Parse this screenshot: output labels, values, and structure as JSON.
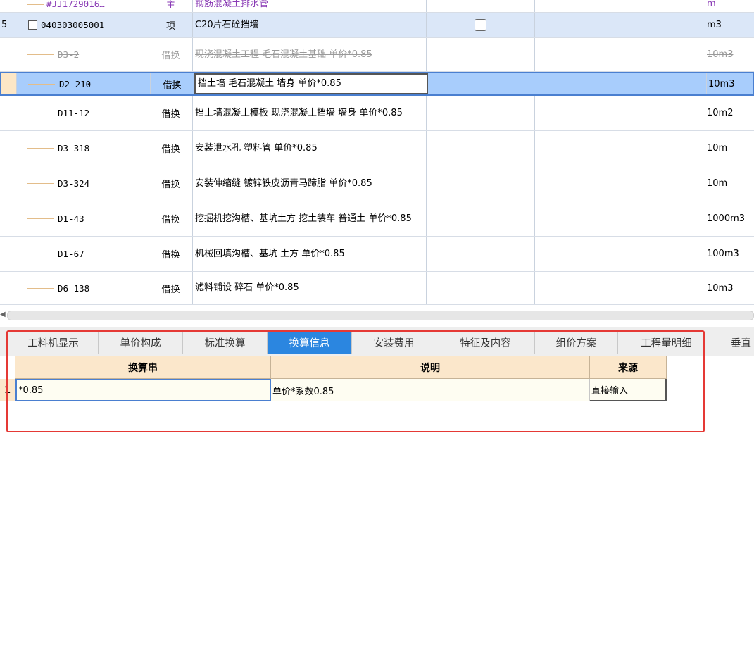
{
  "rows": [
    {
      "code": "#JJ1729016…",
      "type": "主",
      "name": "钢筋混凝土排水管",
      "unit": "m"
    },
    {
      "index": "5",
      "code": "040303005001",
      "type": "项",
      "name": "C20片石砼挡墙",
      "unit": "m3"
    },
    {
      "code": "D3-2",
      "type": "借换",
      "name": "现浇混凝土工程 毛石混凝土基础  单价*0.85",
      "unit": "10m3"
    },
    {
      "code": "D2-210",
      "type": "借换",
      "name": "挡土墙 毛石混凝土 墙身  单价*0.85",
      "unit": "10m3"
    },
    {
      "code": "D11-12",
      "type": "借换",
      "name": "挡土墙混凝土模板 现浇混凝土挡墙 墙身  单价*0.85",
      "unit": "10m2"
    },
    {
      "code": "D3-318",
      "type": "借换",
      "name": "安装泄水孔 塑料管  单价*0.85",
      "unit": "10m"
    },
    {
      "code": "D3-324",
      "type": "借换",
      "name": "安装伸缩缝 镀锌铁皮沥青马蹄脂  单价*0.85",
      "unit": "10m"
    },
    {
      "code": "D1-43",
      "type": "借换",
      "name": "挖掘机挖沟槽、基坑土方 挖土装车 普通土  单价*0.85",
      "unit": "1000m3"
    },
    {
      "code": "D1-67",
      "type": "借换",
      "name": "机械回填沟槽、基坑 土方  单价*0.85",
      "unit": "100m3"
    },
    {
      "code": "D6-138",
      "type": "借换",
      "name": "滤料铺设 碎石  单价*0.85",
      "unit": "10m3"
    }
  ],
  "tabs": [
    "工料机显示",
    "单价构成",
    "标准换算",
    "换算信息",
    "安装费用",
    "特征及内容",
    "组价方案",
    "工程量明细",
    "垂直"
  ],
  "active_tab": "换算信息",
  "subgrid": {
    "headers": [
      "换算串",
      "说明",
      "来源"
    ],
    "row": {
      "index": "1",
      "values": [
        "*0.85",
        "单价*系数0.85",
        "直接输入"
      ]
    }
  },
  "colors": {
    "accent": "#2b86e0",
    "highlight": "#e53935",
    "header_bg": "#fbe7cb"
  }
}
